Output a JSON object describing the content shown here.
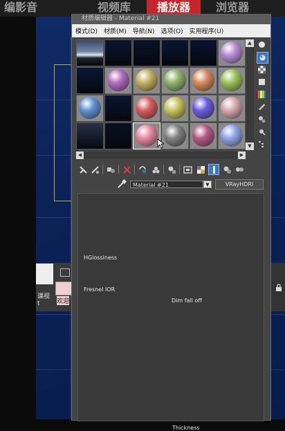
{
  "background_app": {
    "tabs": [
      "编影音",
      "视频库",
      "播放器",
      "浏览器"
    ],
    "active_tab": "播放器",
    "caption_left_1": "课视",
    "caption_left_2": "t",
    "caption_thumb": "欢迎"
  },
  "material_editor": {
    "title": "材质编辑器 - Material #21",
    "menu": [
      "模式(D)",
      "材质(M)",
      "导航(N)",
      "选项(O)",
      "实用程序(U)"
    ],
    "slots": [
      {
        "kind": "sky",
        "color": "#6f86a8"
      },
      {
        "kind": "night",
        "color": "#0b1530"
      },
      {
        "kind": "night",
        "color": "#0a1128"
      },
      {
        "kind": "night",
        "color": "#0b1633"
      },
      {
        "kind": "night",
        "color": "#0a1230"
      },
      {
        "kind": "sphere",
        "color": "#b98ed8"
      },
      {
        "kind": "night",
        "color": "#0b1633"
      },
      {
        "kind": "sphere",
        "color": "#b36ac0"
      },
      {
        "kind": "sphere",
        "color": "#c3b161"
      },
      {
        "kind": "sphere",
        "color": "#8fb26a"
      },
      {
        "kind": "sphere",
        "color": "#d88a5c"
      },
      {
        "kind": "sphere",
        "color": "#9dc35a"
      },
      {
        "kind": "sphere",
        "color": "#5f93d2"
      },
      {
        "kind": "night",
        "color": "#0b1633"
      },
      {
        "kind": "sphere",
        "color": "#d85c5c"
      },
      {
        "kind": "sphere",
        "color": "#c8c35a"
      },
      {
        "kind": "sphere",
        "color": "#6a5ce0"
      },
      {
        "kind": "sphere",
        "color": "#d7a8ad"
      },
      {
        "kind": "night",
        "color": "#2a3048"
      },
      {
        "kind": "night",
        "color": "#0a1020"
      },
      {
        "kind": "sphere",
        "color": "#e887a6"
      },
      {
        "kind": "sphere",
        "color": "#808080"
      },
      {
        "kind": "sphere",
        "color": "#b55a85"
      },
      {
        "kind": "sphere",
        "color": "#8fa6e8"
      }
    ],
    "selected_slot": 20,
    "material_name": "Material #21",
    "material_type": "VRayHDRI",
    "params": {
      "hglossiness": "HGlossiness",
      "fresnel_ior": "Fresnel IOR",
      "dim_fall_off": "Dim fall off",
      "thickness": "Thickness"
    }
  },
  "colors": {
    "accent_tab": "#c4262c",
    "selection_blue": "#3a78c8",
    "viewport_blue": "#0b2258",
    "viewport_frame": "#b7b431"
  }
}
